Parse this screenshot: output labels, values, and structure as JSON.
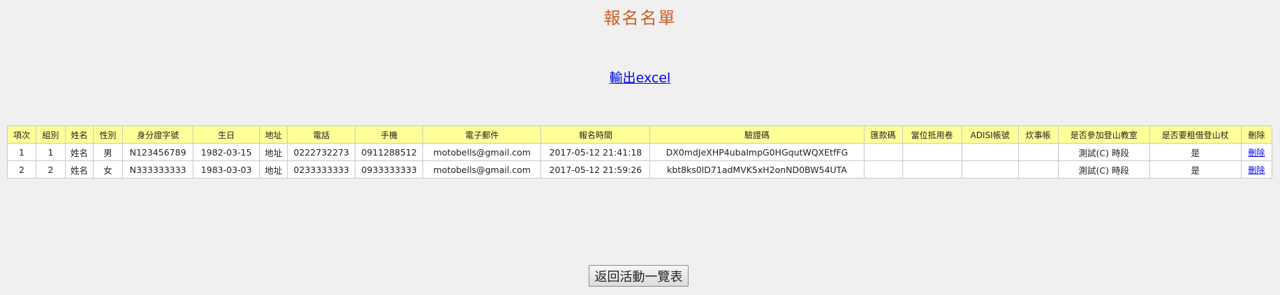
{
  "page": {
    "title": "報名名單",
    "export_link": "輸出excel",
    "back_button": "返回活動一覽表"
  },
  "table": {
    "headers": [
      "項次",
      "組別",
      "姓名",
      "性別",
      "身分證字號",
      "生日",
      "地址",
      "電話",
      "手機",
      "電子郵件",
      "報名時間",
      "驗證碼",
      "匯款碼",
      "當位抵用卷",
      "ADISI帳號",
      "炊事帳",
      "是否參加登山教室",
      "是否要租借登山杖",
      "刪除"
    ],
    "rows": [
      [
        "1",
        "1",
        "姓名",
        "男",
        "N123456789",
        "1982-03-15",
        "地址",
        "0222732273",
        "0911288512",
        "motobells@gmail.com",
        "2017-05-12 21:41:18",
        "DX0mdJeXHP4ubaImpG0HGqutWQXEtfFG",
        "",
        "",
        "",
        "",
        "測試(C) 時段",
        "是",
        "刪除"
      ],
      [
        "2",
        "2",
        "姓名",
        "女",
        "N333333333",
        "1983-03-03",
        "地址",
        "0233333333",
        "0933333333",
        "motobells@gmail.com",
        "2017-05-12 21:59:26",
        "kbt8ks0lD71adMVK5xH2onND0BW54UTA",
        "",
        "",
        "",
        "",
        "測試(C) 時段",
        "是",
        "刪除"
      ]
    ]
  }
}
